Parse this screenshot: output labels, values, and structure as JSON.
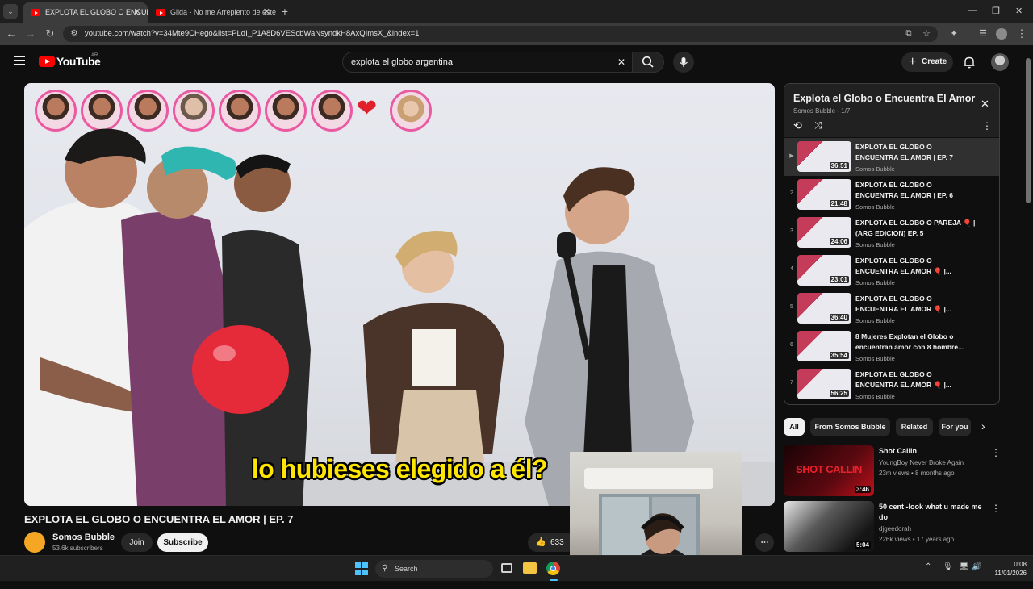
{
  "browser": {
    "tabs": [
      {
        "title": "EXPLOTA EL GLOBO O ENCUENTRA",
        "active": true
      },
      {
        "title": "Gilda - No me Arrepiento de este",
        "active": false
      }
    ],
    "url": "youtube.com/watch?v=34Mte9CHego&list=PLdI_P1A8D6VEScbWaNsyndkH8AxQImsX_&index=1"
  },
  "youtube": {
    "logo_text": "YouTube",
    "region": "AR",
    "search_value": "explota el globo argentina",
    "create_label": "Create"
  },
  "video": {
    "subtitle": "lo hubieses elegido a él?",
    "title": "EXPLOTA EL GLOBO O ENCUENTRA EL AMOR | EP. 7",
    "channel": "Somos Bubble",
    "subscribers": "53.6k subscribers",
    "join_label": "Join",
    "subscribe_label": "Subscribe",
    "likes": "633"
  },
  "playlist": {
    "title": "Explota el Globo o Encuentra El Amor",
    "subtitle": "Somos Bubble - 1/7",
    "items": [
      {
        "index": "▶",
        "title": "EXPLOTA EL GLOBO O ENCUENTRA EL AMOR | EP. 7",
        "channel": "Somos Bubble",
        "duration": "36:51"
      },
      {
        "index": "2",
        "title": "EXPLOTA EL GLOBO O ENCUENTRA EL AMOR | EP. 6",
        "channel": "Somos Bubble",
        "duration": "21:48"
      },
      {
        "index": "3",
        "title": "EXPLOTA EL GLOBO O PAREJA 🎈 | (ARG EDICION) EP. 5",
        "channel": "Somos Bubble",
        "duration": "24:06"
      },
      {
        "index": "4",
        "title": "EXPLOTA EL GLOBO O ENCUENTRA EL AMOR 🎈 |...",
        "channel": "Somos Bubble",
        "duration": "23:01"
      },
      {
        "index": "5",
        "title": "EXPLOTA EL GLOBO O ENCUENTRA EL AMOR 🎈 |...",
        "channel": "Somos Bubble",
        "duration": "36:40"
      },
      {
        "index": "6",
        "title": "8 Mujeres Explotan el Globo o encuentran amor con 8 hombre...",
        "channel": "Somos Bubble",
        "duration": "35:54"
      },
      {
        "index": "7",
        "title": "EXPLOTA EL GLOBO O ENCUENTRA EL AMOR 🎈 |...",
        "channel": "Somos Bubble",
        "duration": "56:25"
      }
    ]
  },
  "chips": [
    "All",
    "From Somos Bubble",
    "Related",
    "For you"
  ],
  "recommendations": [
    {
      "title": "Shot Callin",
      "channel": "YoungBoy Never Broke Again",
      "meta": "23m views • 8 months ago",
      "duration": "3:46",
      "thumb_text": "SHOT CALLIN"
    },
    {
      "title": "50 cent -look what u made me do",
      "channel": "djgeedorah",
      "meta": "226k views • 17 years ago",
      "duration": "5:04",
      "thumb_text": ""
    }
  ],
  "taskbar": {
    "search_placeholder": "Search",
    "time": "0:08",
    "date": "11/01/2026"
  },
  "colors": {
    "accent_red": "#ff0000",
    "bubble_border": "#ea5aa2",
    "subtitle_yellow": "#ffe600"
  }
}
